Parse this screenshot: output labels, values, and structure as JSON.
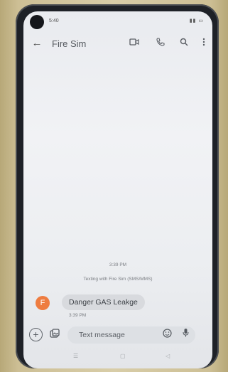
{
  "status": {
    "time": "5:40",
    "icons": "ĥ ıl ▭"
  },
  "appbar": {
    "title": "Fire Sim"
  },
  "conversation": {
    "date_time": "3:39 PM",
    "texting_info": "Texting with Fire Sim (SMS/MMS)",
    "message": {
      "avatar_letter": "F",
      "text": "Danger GAS Leakge",
      "time": "3:39 PM"
    }
  },
  "composer": {
    "placeholder": "Text message"
  },
  "colors": {
    "avatar": "#ee7c40",
    "bubble": "#d8dade",
    "screen": "#eceef1"
  }
}
